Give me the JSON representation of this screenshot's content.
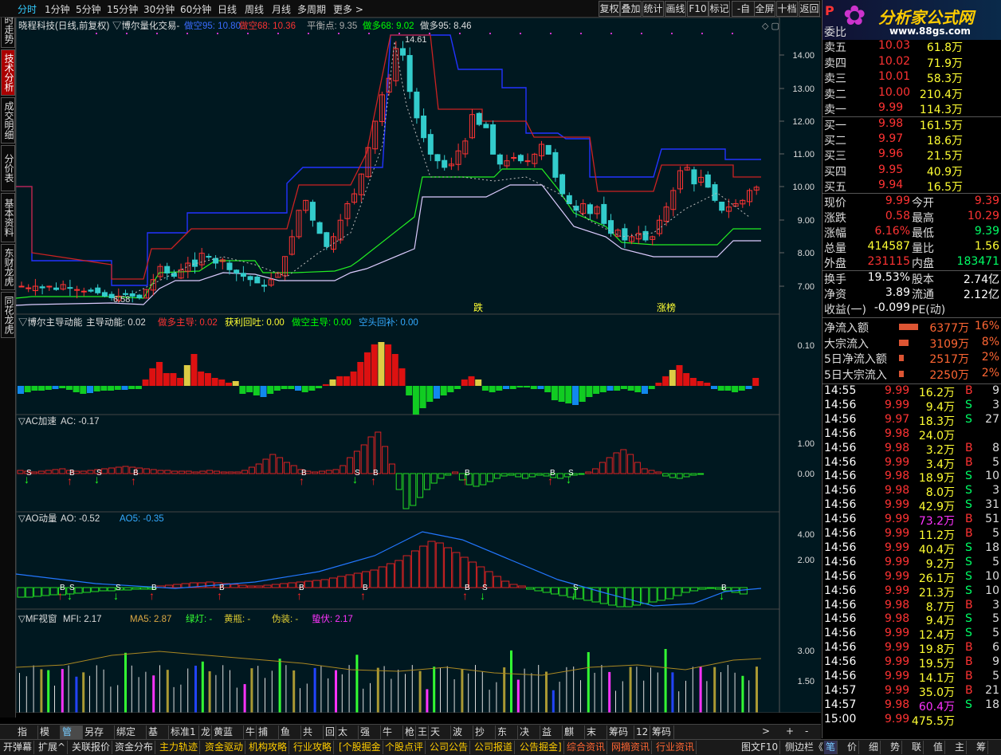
{
  "period_tabs": [
    "分时",
    "1分钟",
    "5分钟",
    "15分钟",
    "30分钟",
    "60分钟",
    "日线",
    "周线",
    "月线",
    "多周期",
    "更多 >"
  ],
  "right_buttons": [
    "复权",
    "叠加",
    "统计",
    "画线",
    "F10",
    "标记",
    "-自选",
    "全屏",
    "十档",
    "返回"
  ],
  "sidebar_items": [
    "分时走势",
    "技术分析",
    "成交明细",
    "分价表",
    "基本资料",
    "东财龙虎",
    "同花龙虎"
  ],
  "logo": {
    "badge": "P",
    "name": "分析家公式网",
    "url": "www.88gs.com"
  },
  "main_title": {
    "stock": "晓程科技(日线,前复权)",
    "indicator": "▽博尔量化交易-",
    "l1": "做空95: 10.80",
    "l2": "做空68: 10.36",
    "l3": "平衡点: 9.35",
    "l4": "做多68: 9.02",
    "l5": "做多95: 8.46"
  },
  "main_axis": [
    "14.00",
    "13.00",
    "12.00",
    "11.00",
    "10.00",
    "9.00",
    "8.00",
    "7.00"
  ],
  "annotations": {
    "hi": "14.61",
    "lo": "6.58",
    "a1": "跌",
    "a2": "涨榜"
  },
  "p2_title": {
    "t": "▽博尔主导动能",
    "a": "主导动能: 0.02",
    "b": "做多主导: 0.02",
    "c": "获利回吐: 0.00",
    "d": "做空主导: 0.00",
    "e": "空头回补: 0.00"
  },
  "p2_axis": [
    "0.10"
  ],
  "p3_title": {
    "t": "▽AC加速",
    "a": "AC: -0.17"
  },
  "p3_axis": [
    "1.00",
    "0.00"
  ],
  "p4_title": {
    "t": "▽AO动量",
    "a": "AO: -0.52",
    "b": "AO5: -0.35"
  },
  "p4_axis": [
    "4.00",
    "2.00"
  ],
  "p5_title": {
    "t": "▽MF视窗",
    "a": "MFI: 2.17",
    "b": "MA5: 2.87",
    "c": "绿灯: -",
    "d": "黄瓶: -",
    "e": "伪装: -",
    "f": "蛰伏: 2.17"
  },
  "p5_axis": [
    "3.00",
    "1.50"
  ],
  "dates": {
    "d0": "20",
    "d1": "2018/05/07/一",
    "d2": "6",
    "d3": "7",
    "d4": "8",
    "dline": "日线"
  },
  "bottom_tabs": [
    "指标",
    "模板",
    "管理",
    "另存为",
    "绑定到",
    "基本",
    "标准1",
    "龙",
    "黄蓝带",
    "牛",
    "捕捞",
    "鱼身",
    "共振",
    "回",
    "太极",
    "强势",
    "牛马",
    "枪",
    "王",
    "天使",
    "波段",
    "抄底",
    "东方",
    "决策",
    "益盟",
    "麒龙",
    "末日",
    "筹码1",
    "12",
    "筹码"
  ],
  "bottom2": [
    "开弹幕",
    "扩展^",
    "关联报价",
    "资金分布",
    "主力轨迹",
    "资金驱动",
    "机构攻略",
    "行业攻略",
    "[个股掘金",
    "个股点评",
    "公司公告",
    "公司报道",
    "公告掘金]",
    "综合资讯",
    "网摘资讯",
    "行业资讯",
    "图文F10",
    "侧边栏《"
  ],
  "bottom2_right": [
    "笔",
    "价",
    "细",
    "势",
    "联",
    "值",
    "主",
    "筹"
  ],
  "quote": {
    "header": "委比",
    "sell": [
      [
        "卖五",
        "10.03",
        "61.8万"
      ],
      [
        "卖四",
        "10.02",
        "71.9万"
      ],
      [
        "卖三",
        "10.01",
        "58.3万"
      ],
      [
        "卖二",
        "10.00",
        "210.4万"
      ],
      [
        "卖一",
        "9.99",
        "114.3万"
      ]
    ],
    "buy": [
      [
        "买一",
        "9.98",
        "161.5万"
      ],
      [
        "买二",
        "9.97",
        "18.6万"
      ],
      [
        "买三",
        "9.96",
        "21.5万"
      ],
      [
        "买四",
        "9.95",
        "40.9万"
      ],
      [
        "买五",
        "9.94",
        "16.5万"
      ]
    ],
    "stats": [
      [
        "现价",
        "9.99",
        "今开",
        "9.39"
      ],
      [
        "涨跌",
        "0.58",
        "最高",
        "10.29"
      ],
      [
        "涨幅",
        "6.16%",
        "最低",
        "9.39"
      ],
      [
        "总量",
        "414587",
        "量比",
        "1.56"
      ],
      [
        "外盘",
        "231115",
        "内盘",
        "183471"
      ]
    ],
    "stats2": [
      [
        "换手",
        "19.53%",
        "股本",
        "2.74亿"
      ],
      [
        "净资",
        "3.89",
        "流通",
        "2.12亿"
      ],
      [
        "收益(一)",
        "-0.099",
        "PE(动)",
        ""
      ]
    ],
    "flows": [
      [
        "净流入额",
        "6377万",
        "16%"
      ],
      [
        "大宗流入",
        "3109万",
        "8%"
      ],
      [
        "5日净流入额",
        "2517万",
        "2%"
      ],
      [
        "5日大宗流入",
        "2250万",
        "2%"
      ]
    ],
    "ticks": [
      [
        "14:55",
        "9.99",
        "16.2万",
        "B",
        "9"
      ],
      [
        "14:56",
        "9.99",
        "9.4万",
        "S",
        "3"
      ],
      [
        "14:56",
        "9.97",
        "18.3万",
        "S",
        "27"
      ],
      [
        "14:56",
        "9.98",
        "24.0万",
        "",
        ""
      ],
      [
        "14:56",
        "9.98",
        "3.2万",
        "B",
        "8"
      ],
      [
        "14:56",
        "9.99",
        "3.4万",
        "B",
        "5"
      ],
      [
        "14:56",
        "9.98",
        "18.9万",
        "S",
        "10"
      ],
      [
        "14:56",
        "9.98",
        "8.0万",
        "S",
        "3"
      ],
      [
        "14:56",
        "9.99",
        "42.9万",
        "S",
        "31"
      ],
      [
        "14:56",
        "9.99",
        "73.2万",
        "B",
        "51"
      ],
      [
        "14:56",
        "9.99",
        "11.2万",
        "B",
        "5"
      ],
      [
        "14:56",
        "9.99",
        "40.4万",
        "S",
        "18"
      ],
      [
        "14:56",
        "9.99",
        "9.2万",
        "S",
        "5"
      ],
      [
        "14:56",
        "9.99",
        "26.1万",
        "S",
        "10"
      ],
      [
        "14:56",
        "9.99",
        "21.3万",
        "S",
        "10"
      ],
      [
        "14:56",
        "9.98",
        "8.7万",
        "B",
        "3"
      ],
      [
        "14:56",
        "9.98",
        "9.4万",
        "S",
        "5"
      ],
      [
        "14:56",
        "9.99",
        "12.4万",
        "S",
        "5"
      ],
      [
        "14:56",
        "9.99",
        "19.8万",
        "B",
        "6"
      ],
      [
        "14:56",
        "9.99",
        "19.5万",
        "B",
        "9"
      ],
      [
        "14:56",
        "9.99",
        "14.1万",
        "B",
        "5"
      ],
      [
        "14:57",
        "9.99",
        "35.0万",
        "B",
        "21"
      ],
      [
        "14:57",
        "9.98",
        "60.4万",
        "S",
        "18"
      ],
      [
        "15:00",
        "9.99",
        "475.5万",
        "",
        ""
      ]
    ]
  },
  "colors": {
    "up": "#ff3333",
    "down": "#00ff00",
    "cyan": "#00ccff",
    "yellow": "#ffff00",
    "navy": "#3a6cff"
  }
}
